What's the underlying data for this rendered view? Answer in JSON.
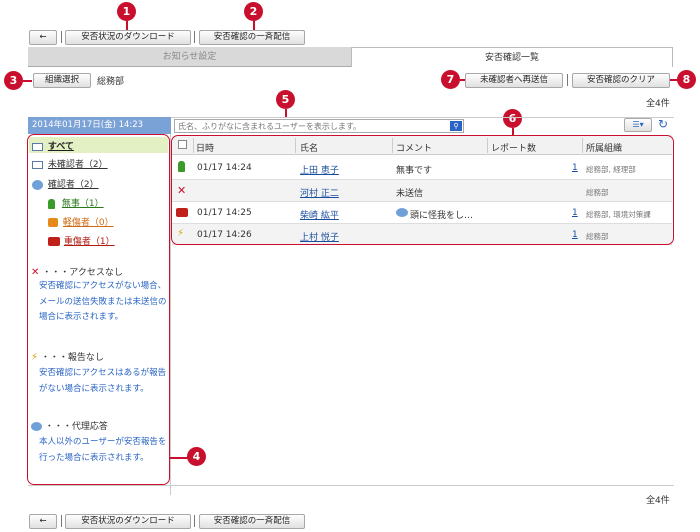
{
  "toolbar": {
    "back_label": "←",
    "download_label": "安否状況のダウンロード",
    "broadcast_label": "安否確認の一斉配信"
  },
  "tabs": [
    {
      "label": "お知らせ設定"
    },
    {
      "label": "安否確認一覧"
    }
  ],
  "org": {
    "select_label": "組織選択",
    "current": "総務部"
  },
  "actions": {
    "resend_label": "未確認者へ再送信",
    "clear_label": "安否確認のクリア"
  },
  "total": "全4件",
  "sidebar": {
    "date": "2014年01月17日(金) 14:23",
    "items": [
      {
        "label": "すべて"
      },
      {
        "label": "未確認者（2）"
      },
      {
        "label": "確認者（2）"
      },
      {
        "label": "無事（1）"
      },
      {
        "label": "軽傷者（0）"
      },
      {
        "label": "重傷者（1）"
      }
    ],
    "legend": [
      {
        "title": "・・・アクセスなし",
        "text": "安否確認にアクセスがない場合、メールの送信失敗または未送信の場合に表示されます。"
      },
      {
        "title": "・・・報告なし",
        "text": "安否確認にアクセスはあるが報告がない場合に表示されます。"
      },
      {
        "title": "・・・代理応答",
        "text": "本人以外のユーザーが安否報告を行った場合に表示されます。"
      }
    ]
  },
  "search": {
    "placeholder": "氏名、ふりがなに含まれるユーザーを表示します。"
  },
  "table": {
    "headers": [
      "日時",
      "氏名",
      "コメント",
      "レポート数",
      "所属組織"
    ],
    "rows": [
      {
        "status": "safe-icon",
        "datetime": "01/17 14:24",
        "name": "上田 恵子",
        "comment": "無事です",
        "reports": "1",
        "org": "総務部, 経理部"
      },
      {
        "status": "x-icon",
        "datetime": "",
        "name": "河村 正二",
        "comment": "未送信",
        "reports": "",
        "org": "総務部"
      },
      {
        "status": "ambulance-icon",
        "datetime": "01/17 14:25",
        "name": "柴崎 紘平",
        "comment": "頭に怪我をし…",
        "reports": "1",
        "org": "総務部, 環境対策課"
      },
      {
        "status": "lightning-icon",
        "datetime": "01/17 14:26",
        "name": "上村 悦子",
        "comment": "",
        "reports": "1",
        "org": "総務部"
      }
    ]
  },
  "callouts": [
    "1",
    "2",
    "3",
    "4",
    "5",
    "6",
    "7",
    "8"
  ],
  "colors": {
    "accent": "#c8102e",
    "link": "#1a4fa0",
    "header_blue": "#7ba2d6"
  }
}
